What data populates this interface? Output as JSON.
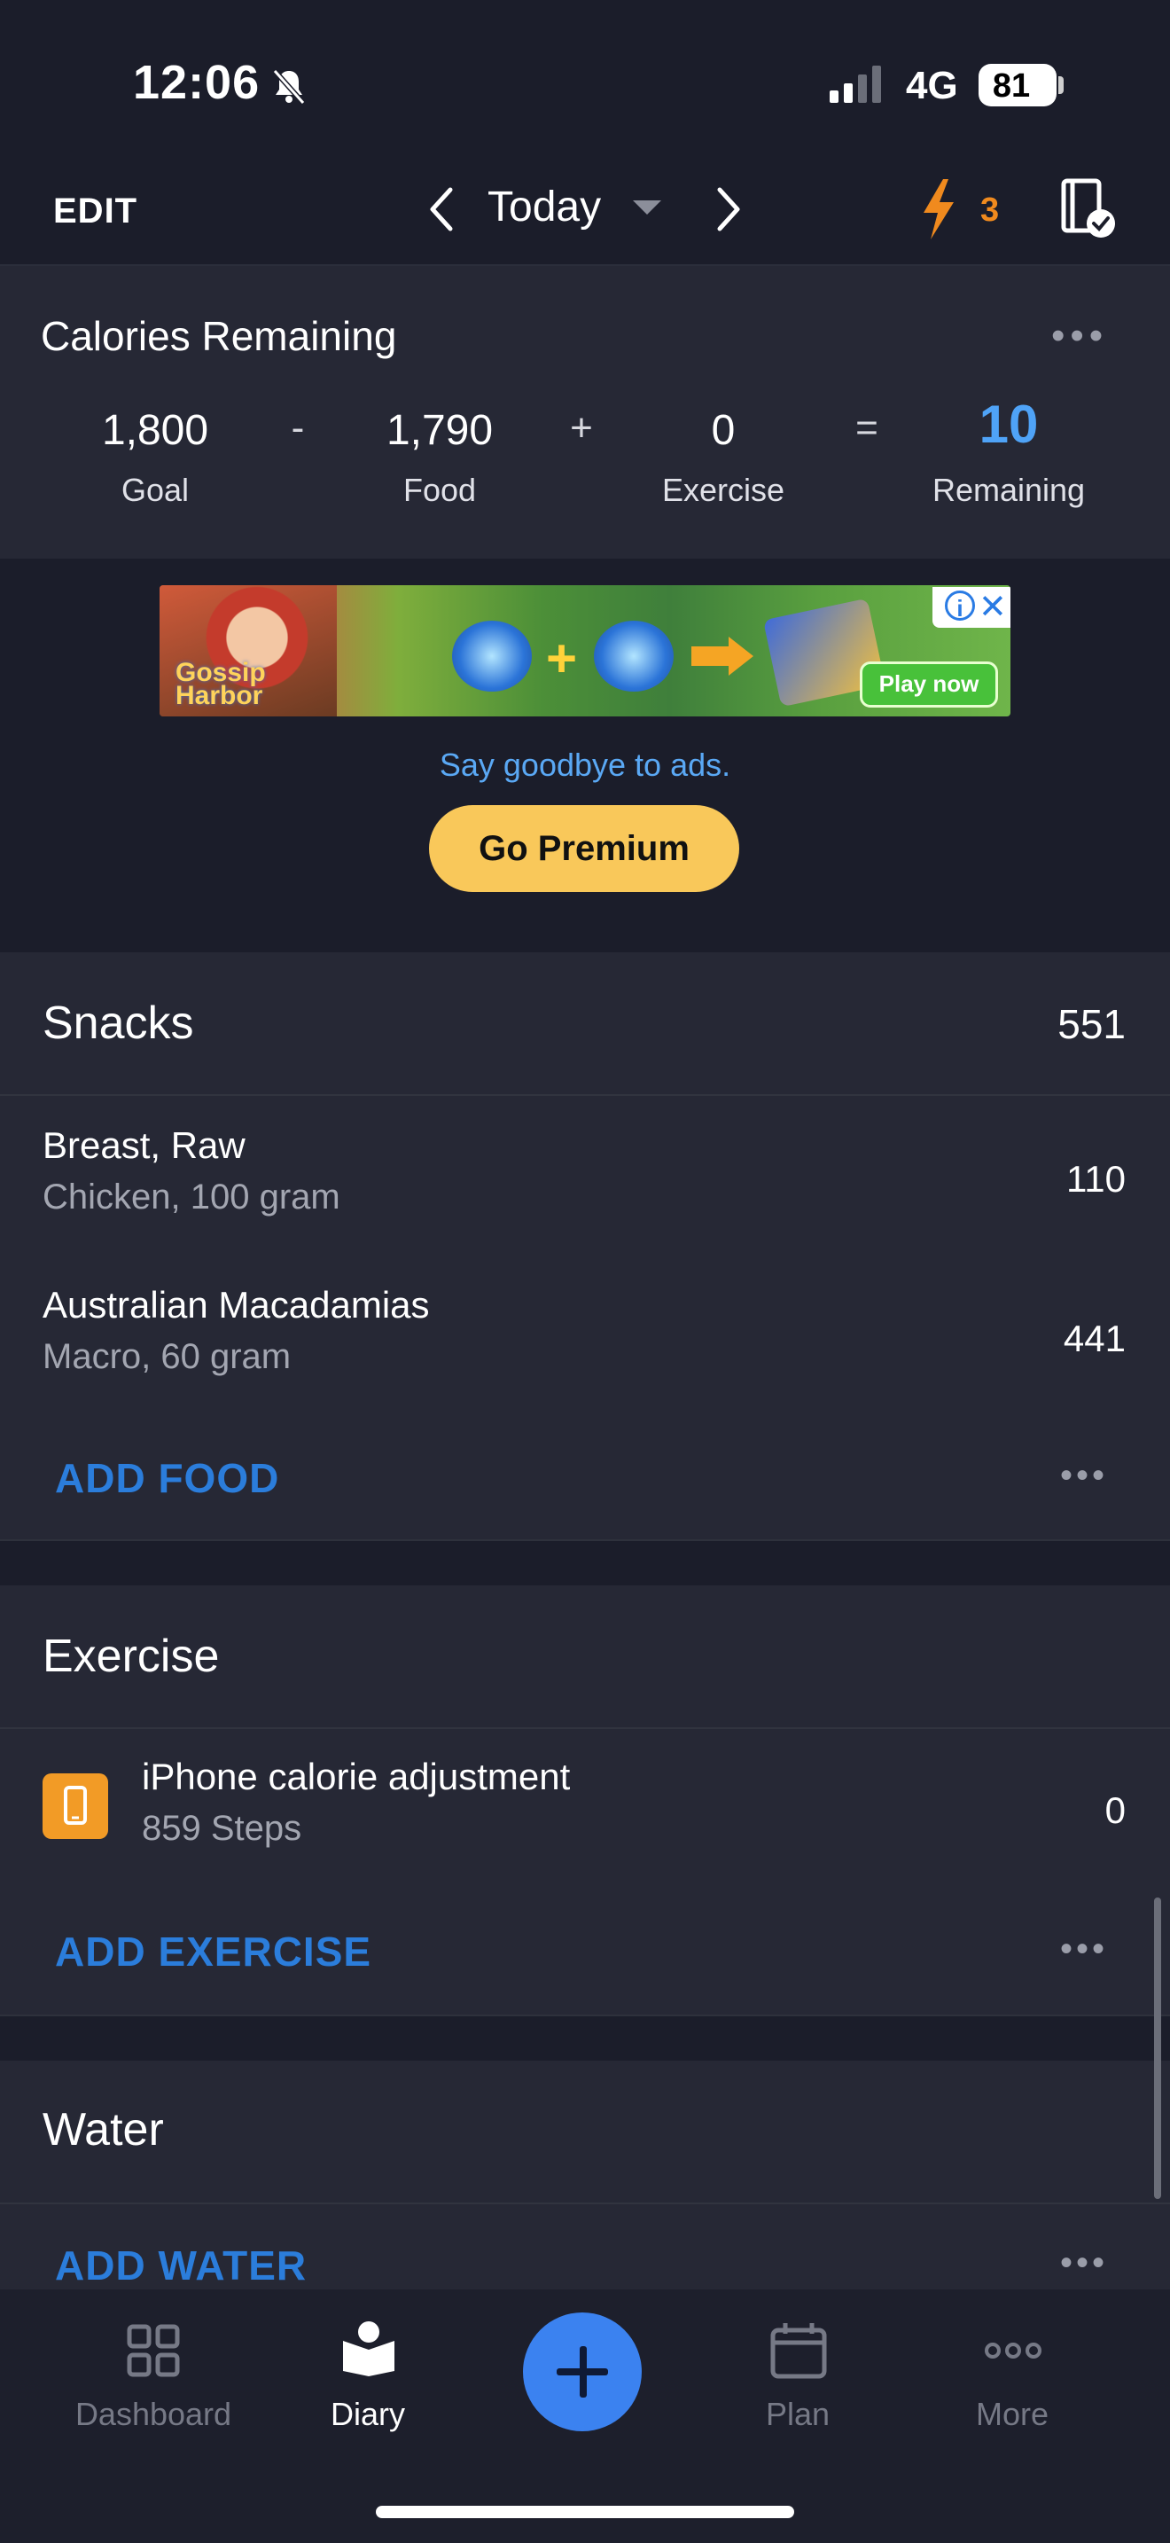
{
  "status_bar": {
    "time": "12:06",
    "network": "4G",
    "battery": "81"
  },
  "top_nav": {
    "edit": "EDIT",
    "date": "Today",
    "streak_count": "3"
  },
  "calories": {
    "title": "Calories Remaining",
    "goal": "1,800",
    "goal_label": "Goal",
    "minus": "-",
    "food": "1,790",
    "food_label": "Food",
    "plus": "+",
    "exercise": "0",
    "exercise_label": "Exercise",
    "equals": "=",
    "remaining": "10",
    "remaining_label": "Remaining"
  },
  "ad": {
    "logo_line1": "Gossip",
    "logo_line2": "Harbor",
    "play_label": "Play now",
    "info": "i",
    "close": "✕"
  },
  "promo": {
    "message": "Say goodbye to ads.",
    "button": "Go Premium"
  },
  "snacks": {
    "title": "Snacks",
    "total": "551",
    "items": [
      {
        "name": "Breast, Raw",
        "detail": "Chicken, 100 gram",
        "calories": "110"
      },
      {
        "name": "Australian Macadamias",
        "detail": "Macro, 60 gram",
        "calories": "441"
      }
    ],
    "add_label": "ADD FOOD"
  },
  "exercise": {
    "title": "Exercise",
    "items": [
      {
        "name": "iPhone calorie adjustment",
        "detail": "859 Steps",
        "calories": "0"
      }
    ],
    "add_label": "ADD EXERCISE"
  },
  "water": {
    "title": "Water",
    "add_label": "ADD WATER"
  },
  "tabs": [
    {
      "label": "Dashboard",
      "icon": "dashboard-icon"
    },
    {
      "label": "Diary",
      "icon": "diary-icon"
    },
    {
      "label": "Plan",
      "icon": "calendar-icon"
    },
    {
      "label": "More",
      "icon": "more-icon"
    }
  ],
  "colors": {
    "background": "#1b1d2a",
    "card": "#262835",
    "accent_blue": "#2b7ddb",
    "remaining_blue": "#4fa3f7",
    "premium_yellow": "#f9c85a",
    "streak_orange": "#f08a1e"
  }
}
